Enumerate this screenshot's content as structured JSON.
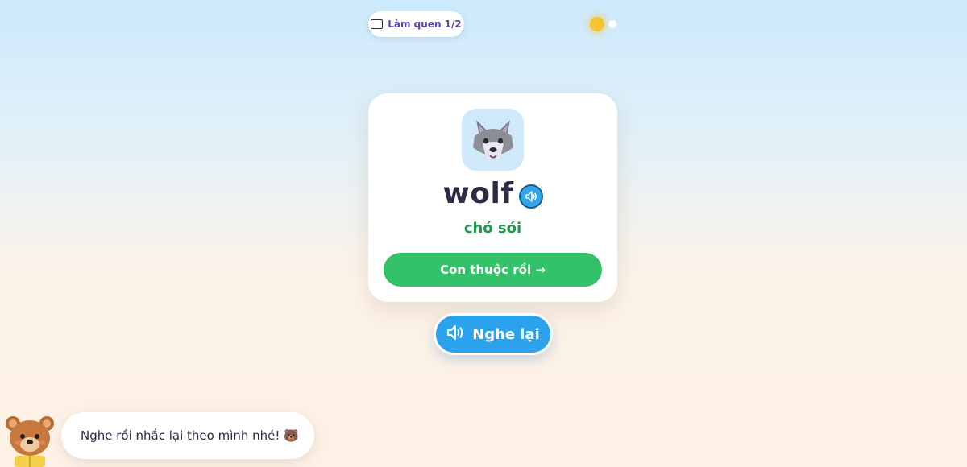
{
  "header": {
    "progress_label": "Làm quen 1/2",
    "icon": "book-icon"
  },
  "theme_toggle": {
    "icon": "sun-icon",
    "mode": "light"
  },
  "card": {
    "emoji": "wolf-icon",
    "word": "wolf",
    "meaning": "chó sói",
    "know_button_label": "Con thuộc rồi →",
    "speak_icon": "speaker-icon"
  },
  "replay_button": {
    "label": "Nghe lại",
    "icon": "speaker-icon"
  },
  "mascot": {
    "icon": "bear-icon",
    "message": "Nghe rồi nhắc lại theo mình nhé! 🐻"
  },
  "colors": {
    "accent_green": "#33c16a",
    "accent_blue": "#2aa3ec",
    "meaning_green": "#1e9a50",
    "progress_purple": "#5b3fb8"
  }
}
